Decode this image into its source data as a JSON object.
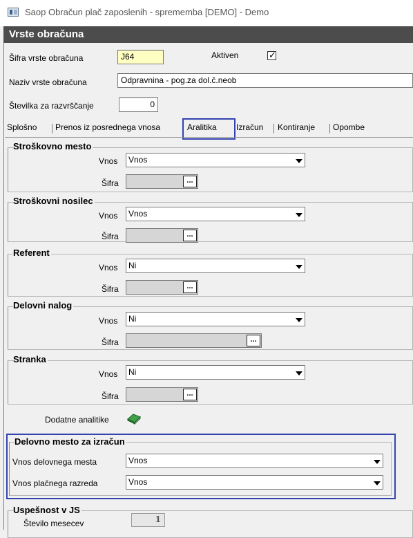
{
  "window": {
    "title": "Saop Obračun plač zaposlenih - sprememba [DEMO] - Demo"
  },
  "header": {
    "title": "Vrste obračuna"
  },
  "form": {
    "sifra_label": "Šifra vrste obračuna",
    "sifra_value": "J64",
    "aktiven_label": "Aktiven",
    "aktiven_checked": true,
    "naziv_label": "Naziv vrste obračuna",
    "naziv_value": "Odpravnina - pog.za dol.č.neob",
    "stevilka_label": "Številka  za razvrščanje",
    "stevilka_value": "0"
  },
  "tabs": [
    {
      "label": "Splošno"
    },
    {
      "label": "Prenos iz posrednega vnosa"
    },
    {
      "label": "Aralitika",
      "active": true
    },
    {
      "label": "Izračun"
    },
    {
      "label": "Kontiranje"
    },
    {
      "label": "Opombe"
    }
  ],
  "groups": [
    {
      "title": "Stroškovno mesto",
      "vnos_label": "Vnos",
      "vnos_value": "Vnos",
      "sifra_label": "Šifra",
      "picker_btn": "..."
    },
    {
      "title": "Stroškovni nosilec",
      "vnos_label": "Vnos",
      "vnos_value": "Vnos",
      "sifra_label": "Šifra",
      "picker_btn": "..."
    },
    {
      "title": "Referent",
      "vnos_label": "Vnos",
      "vnos_value": "Ni",
      "sifra_label": "Šifra",
      "picker_btn": "..."
    },
    {
      "title": "Delovni nalog",
      "vnos_label": "Vnos",
      "vnos_value": "Ni",
      "sifra_label": "Šifra",
      "picker_btn": "..."
    },
    {
      "title": "Stranka",
      "vnos_label": "Vnos",
      "vnos_value": "Ni",
      "sifra_label": "Šifra",
      "picker_btn": "..."
    }
  ],
  "dodatne": {
    "label": "Dodatne analitike",
    "icon": "book-icon"
  },
  "delovno_mesto": {
    "title": "Delovno mesto za izračun",
    "vnos_dm_label": "Vnos delovnega mesta",
    "vnos_dm_value": "Vnos",
    "vnos_pr_label": "Vnos plačnega razreda",
    "vnos_pr_value": "Vnos"
  },
  "uspesnost": {
    "title": "Uspešnost v JS",
    "stevilo_label": "Število mesecev",
    "stevilo_value": "1"
  },
  "colors": {
    "header_bg": "#4c4c4c",
    "highlight": "#3344b0",
    "required_field": "#ffffc4"
  }
}
